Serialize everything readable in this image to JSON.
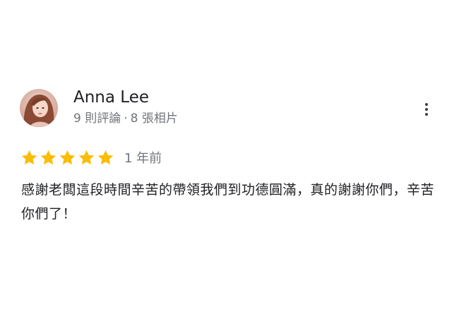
{
  "review": {
    "author": {
      "name": "Anna Lee",
      "reviews_count": "9 則評論",
      "separator": "·",
      "photos_count": "8 張相片",
      "avatar": "profile-photo"
    },
    "rating": {
      "stars": 5,
      "max": 5,
      "color": "#fbbc04"
    },
    "time": "1 年前",
    "text": "感謝老闆這段時間辛苦的帶領我們到功德圓滿，真的謝謝你們，辛苦你們了！",
    "menu_icon": "more-vert-icon"
  }
}
